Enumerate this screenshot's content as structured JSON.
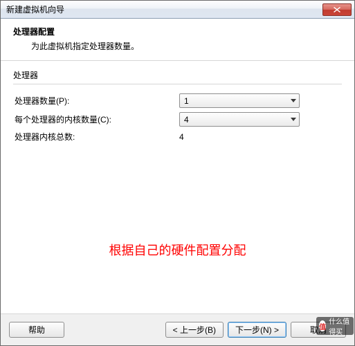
{
  "window": {
    "title": "新建虚拟机向导"
  },
  "header": {
    "title": "处理器配置",
    "subtitle": "为此虚拟机指定处理器数量。"
  },
  "group": {
    "label": "处理器",
    "rows": {
      "processor_count": {
        "label": "处理器数量(P):",
        "value": "1"
      },
      "cores_per_processor": {
        "label": "每个处理器的内核数量(C):",
        "value": "4"
      },
      "total_cores": {
        "label": "处理器内核总数:",
        "value": "4"
      }
    }
  },
  "annotation": "根据自己的硬件配置分配",
  "buttons": {
    "help": "帮助",
    "back": "< 上一步(B)",
    "next": "下一步(N) >",
    "cancel": "取消"
  },
  "watermark": {
    "logo": "值",
    "text": "什么值得买"
  },
  "colors": {
    "annotation": "#ff0000",
    "close_bg": "#c13c30",
    "default_border": "#3c7fb1"
  }
}
